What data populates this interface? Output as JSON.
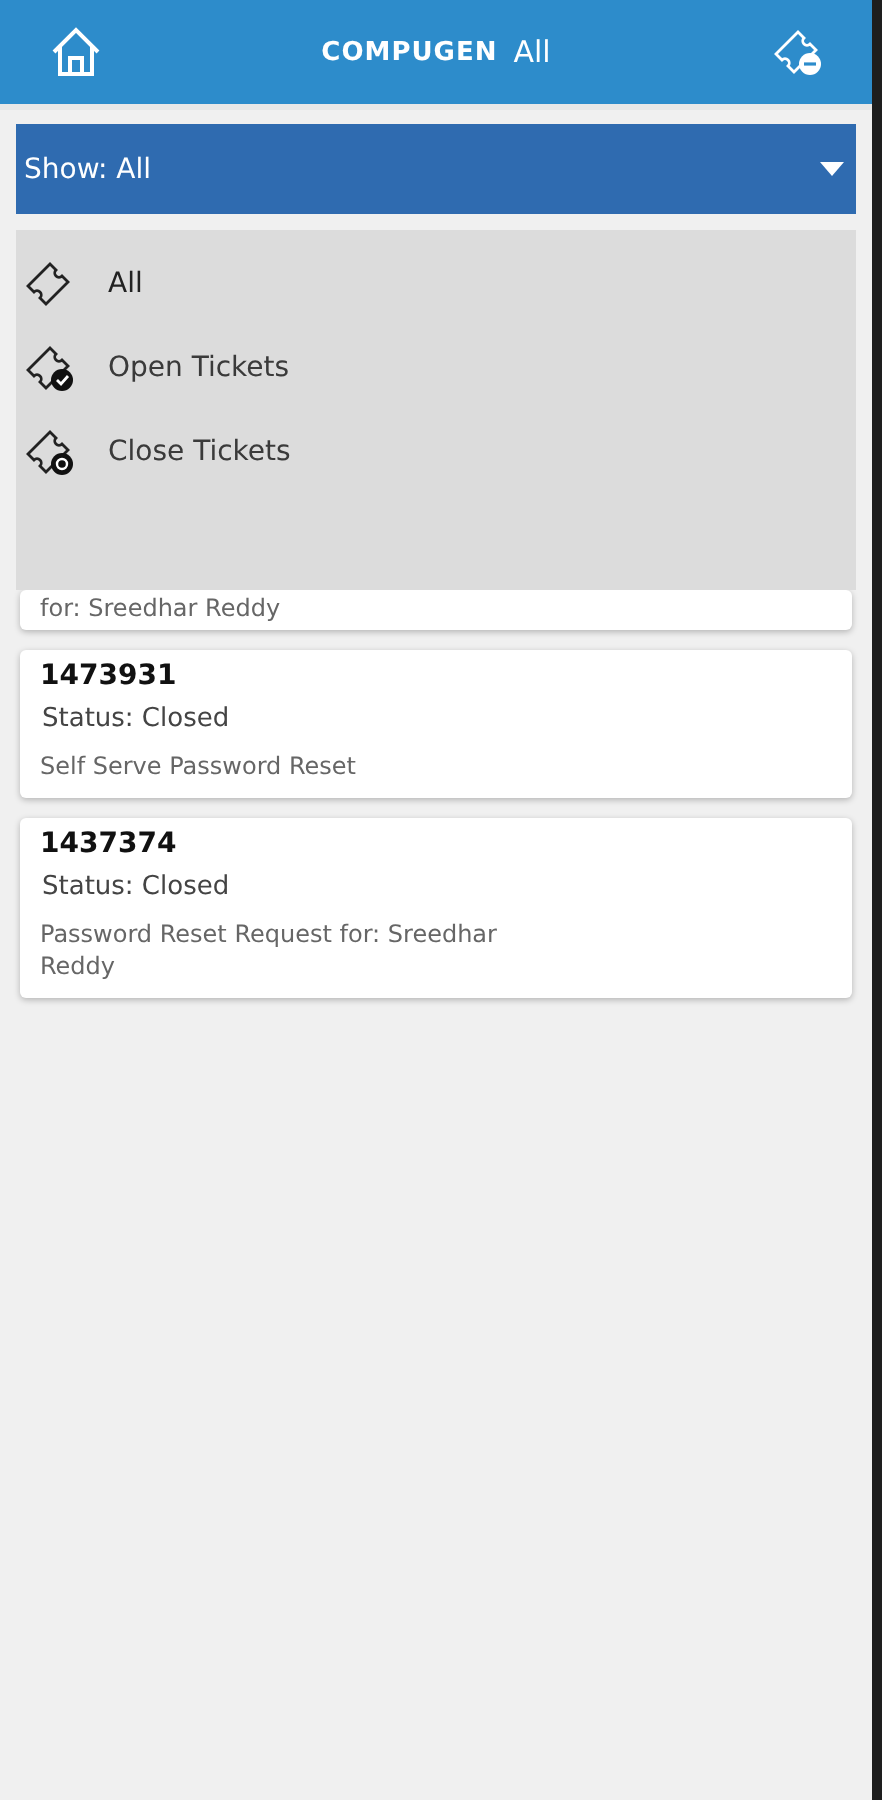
{
  "header": {
    "brand": "COMPUGEN",
    "title": "All"
  },
  "filter": {
    "label": "Show: All",
    "expanded": true
  },
  "menu": [
    {
      "label": "All",
      "kind": "all",
      "selected": true
    },
    {
      "label": "Open Tickets",
      "kind": "open",
      "selected": false
    },
    {
      "label": "Close Tickets",
      "kind": "closed",
      "selected": false
    }
  ],
  "tickets": [
    {
      "description": "for: Sreedhar Reddy",
      "partial": true
    },
    {
      "id": "1473931",
      "status": "Status: Closed",
      "description": "Self Serve Password Reset",
      "partial": false
    },
    {
      "id": "1437374",
      "status": "Status: Closed",
      "description": "Password Reset Request for: Sreedhar Reddy",
      "partial": false
    }
  ]
}
